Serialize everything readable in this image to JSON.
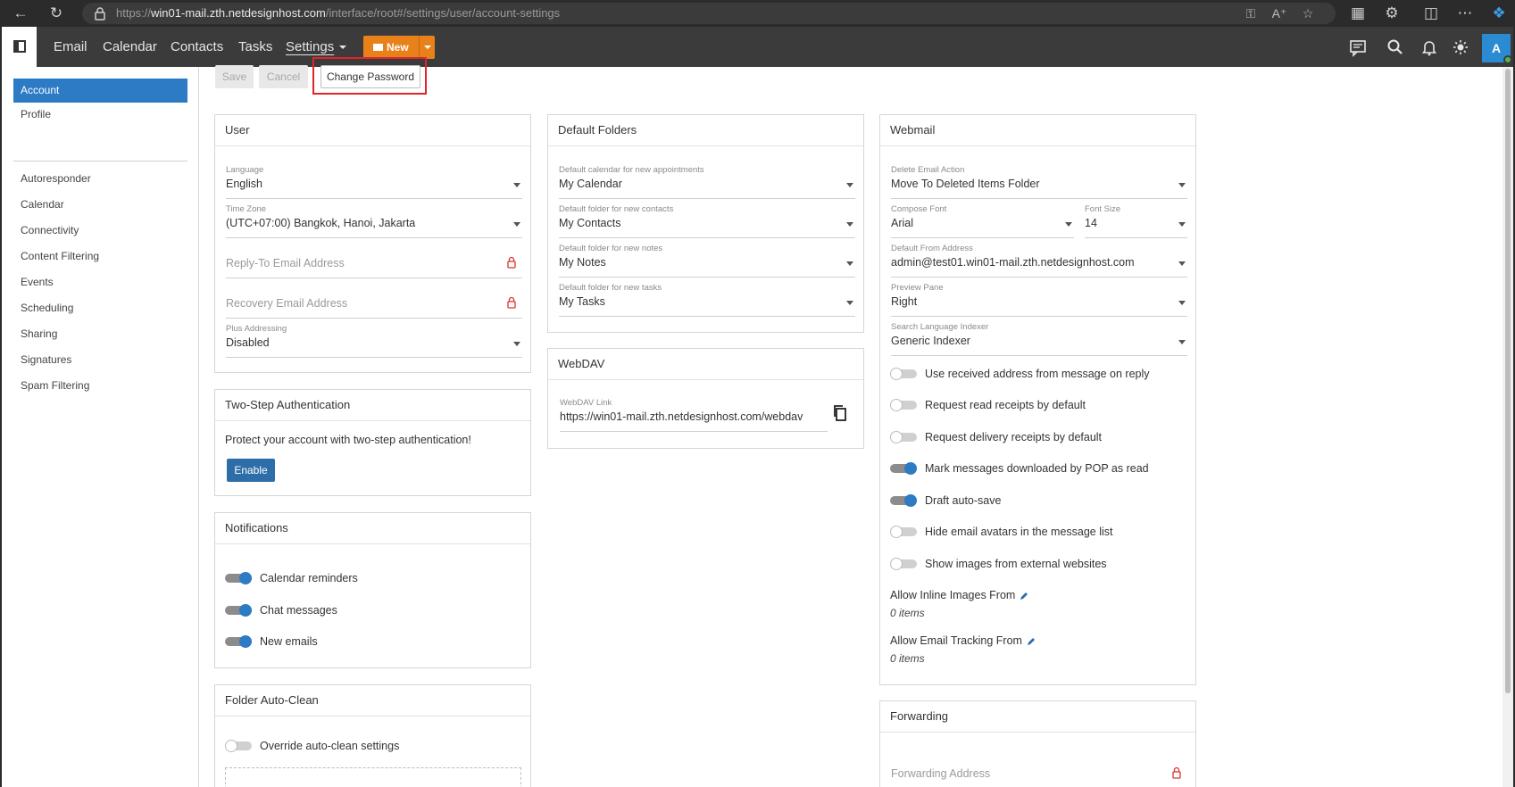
{
  "browser": {
    "url_prefix": "https://",
    "url_host": "win01-mail.zth.netdesignhost.com",
    "url_path": "/interface/root#/settings/user/account-settings"
  },
  "topnav": {
    "links": [
      "Email",
      "Calendar",
      "Contacts",
      "Tasks",
      "Settings"
    ],
    "new_label": "New",
    "avatar_letter": "A"
  },
  "leftnav": {
    "items": [
      "Account",
      "Profile",
      "Autoresponder",
      "Calendar",
      "Connectivity",
      "Content Filtering",
      "Events",
      "Scheduling",
      "Sharing",
      "Signatures",
      "Spam Filtering"
    ]
  },
  "toolbar": {
    "save": "Save",
    "cancel": "Cancel",
    "change_password": "Change Password"
  },
  "user": {
    "title": "User",
    "language_label": "Language",
    "language": "English",
    "timezone_label": "Time Zone",
    "timezone": "(UTC+07:00) Bangkok, Hanoi, Jakarta",
    "reply_to_placeholder": "Reply-To Email Address",
    "recovery_placeholder": "Recovery Email Address",
    "plus_label": "Plus Addressing",
    "plus": "Disabled"
  },
  "two_step": {
    "title": "Two-Step Authentication",
    "text": "Protect your account with two-step authentication!",
    "enable": "Enable"
  },
  "notifications": {
    "title": "Notifications",
    "items": [
      {
        "label": "Calendar reminders",
        "on": true
      },
      {
        "label": "Chat messages",
        "on": true
      },
      {
        "label": "New emails",
        "on": true
      }
    ]
  },
  "folder_autoclean": {
    "title": "Folder Auto-Clean",
    "override_label": "Override auto-clean settings",
    "override_on": false
  },
  "default_folders": {
    "title": "Default Folders",
    "fields": [
      {
        "label": "Default calendar for new appointments",
        "value": "My Calendar"
      },
      {
        "label": "Default folder for new contacts",
        "value": "My Contacts"
      },
      {
        "label": "Default folder for new notes",
        "value": "My Notes"
      },
      {
        "label": "Default folder for new tasks",
        "value": "My Tasks"
      }
    ]
  },
  "webdav": {
    "title": "WebDAV",
    "link_label": "WebDAV Link",
    "link": "https://win01-mail.zth.netdesignhost.com/webdav"
  },
  "webmail": {
    "title": "Webmail",
    "delete_label": "Delete Email Action",
    "delete": "Move To Deleted Items Folder",
    "font_label": "Compose Font",
    "font": "Arial",
    "size_label": "Font Size",
    "size": "14",
    "from_label": "Default From Address",
    "from": "admin@test01.win01-mail.zth.netdesignhost.com",
    "preview_label": "Preview Pane",
    "preview": "Right",
    "indexer_label": "Search Language Indexer",
    "indexer": "Generic Indexer",
    "toggles": [
      {
        "label": "Use received address from message on reply",
        "on": false
      },
      {
        "label": "Request read receipts by default",
        "on": false
      },
      {
        "label": "Request delivery receipts by default",
        "on": false
      },
      {
        "label": "Mark messages downloaded by POP as read",
        "on": true
      },
      {
        "label": "Draft auto-save",
        "on": true
      },
      {
        "label": "Hide email avatars in the message list",
        "on": false
      },
      {
        "label": "Show images from external websites",
        "on": false
      }
    ],
    "inline_images_label": "Allow Inline Images From",
    "inline_images_count": "0 items",
    "tracking_label": "Allow Email Tracking From",
    "tracking_count": "0 items"
  },
  "forwarding": {
    "title": "Forwarding",
    "address_placeholder": "Forwarding Address"
  }
}
